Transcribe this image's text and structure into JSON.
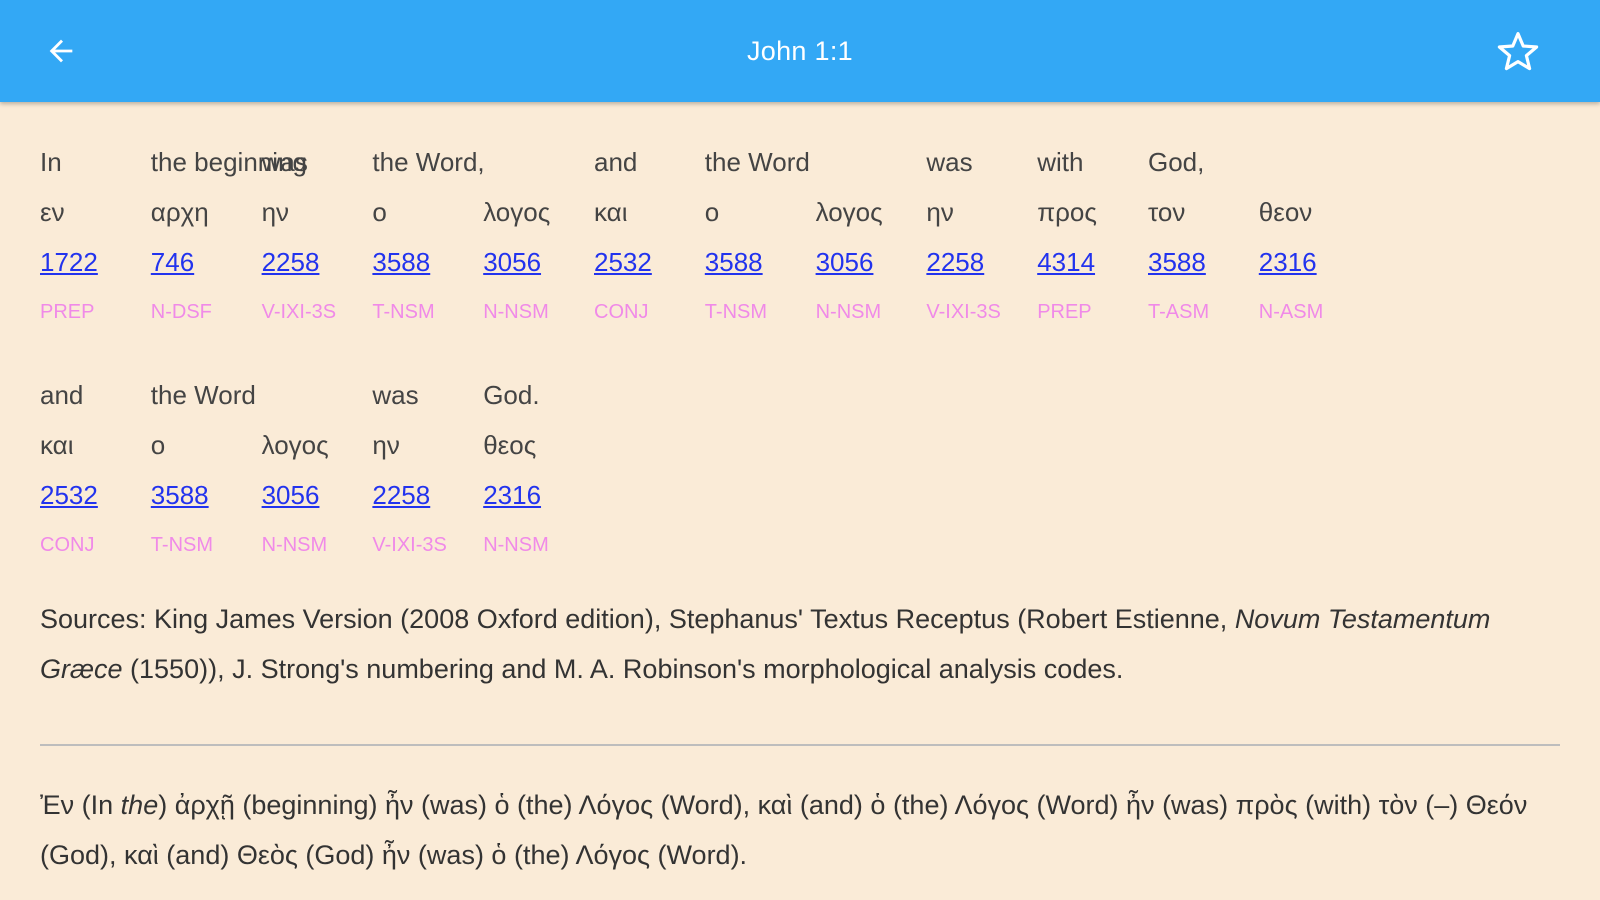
{
  "appbar": {
    "title": "John 1:1",
    "back_icon": "arrow-left-icon",
    "star_icon": "star-outline-icon"
  },
  "verse_rows": [
    [
      {
        "en": "In",
        "gr": "εν",
        "num": "1722",
        "morph": "PREP"
      },
      {
        "en": "the beginning",
        "gr": "αρχη",
        "num": "746",
        "morph": "N-DSF"
      },
      {
        "en": "was",
        "gr": "ην",
        "num": "2258",
        "morph": "V-IXI-3S"
      },
      {
        "en": "the Word,",
        "gr": "ο",
        "num": "3588",
        "morph": "T-NSM"
      },
      {
        "en": "",
        "gr": "λογος",
        "num": "3056",
        "morph": "N-NSM"
      },
      {
        "en": "and",
        "gr": "και",
        "num": "2532",
        "morph": "CONJ"
      },
      {
        "en": "the Word",
        "gr": "ο",
        "num": "3588",
        "morph": "T-NSM"
      },
      {
        "en": "",
        "gr": "λογος",
        "num": "3056",
        "morph": "N-NSM"
      },
      {
        "en": "was",
        "gr": "ην",
        "num": "2258",
        "morph": "V-IXI-3S"
      },
      {
        "en": "with",
        "gr": "προς",
        "num": "4314",
        "morph": "PREP"
      },
      {
        "en": "God,",
        "gr": "τον",
        "num": "3588",
        "morph": "T-ASM"
      },
      {
        "en": "",
        "gr": "θεον",
        "num": "2316",
        "morph": "N-ASM"
      }
    ],
    [
      {
        "en": "and",
        "gr": "και",
        "num": "2532",
        "morph": "CONJ"
      },
      {
        "en": "the Word",
        "gr": "ο",
        "num": "3588",
        "morph": "T-NSM"
      },
      {
        "en": "",
        "gr": "λογος",
        "num": "3056",
        "morph": "N-NSM"
      },
      {
        "en": "was",
        "gr": "ην",
        "num": "2258",
        "morph": "V-IXI-3S"
      },
      {
        "en": "God.",
        "gr": "θεος",
        "num": "2316",
        "morph": "N-NSM"
      }
    ]
  ],
  "sources": {
    "part1": "Sources: King James Version (2008 Oxford edition), Stephanus' Textus Receptus (Robert Estienne, ",
    "italic": "Novum Testamentum Græce",
    "part2": " (1550)), J. Strong's numbering and M. A. Robinson's morphological analysis codes."
  },
  "interlinear": {
    "part1": "Ἐν (In ",
    "italic": "the",
    "part2": ") ἀρχῇ (beginning) ἦν (was) ὁ (the) Λόγος (Word), καὶ (and) ὁ (the) Λόγος (Word) ἦν (was) πρὸς (with) τὸν (–) Θεόν (God), καὶ (and) Θεὸς (God) ἦν (was) ὁ (the) Λόγος (Word)."
  }
}
